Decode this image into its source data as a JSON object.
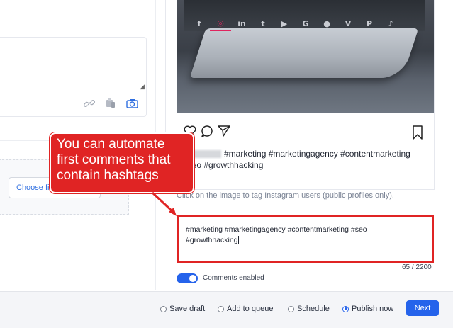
{
  "left_panel": {
    "upload_button_label": "Choose fi",
    "icons": [
      "link-icon",
      "media-library-icon",
      "camera-icon"
    ]
  },
  "network_tabs": [
    {
      "icon": "facebook-icon",
      "glyph": "f"
    },
    {
      "icon": "instagram-icon",
      "glyph": "◎",
      "active": true
    },
    {
      "icon": "linkedin-icon",
      "glyph": "in"
    },
    {
      "icon": "twitter-icon",
      "glyph": "t"
    },
    {
      "icon": "youtube-icon",
      "glyph": "▶"
    },
    {
      "icon": "google-icon",
      "glyph": "G"
    },
    {
      "icon": "reddit-icon",
      "glyph": "●"
    },
    {
      "icon": "vimeo-icon",
      "glyph": "V"
    },
    {
      "icon": "pinterest-icon",
      "glyph": "P"
    },
    {
      "icon": "tiktok-icon",
      "glyph": "♪"
    }
  ],
  "preview": {
    "caption_tags": "#marketing #marketingagency #contentmarketing",
    "caption_tags_line2": "#seo #growthhacking",
    "tag_hint": "Click on the image to tag Instagram users (public profiles only)."
  },
  "first_comment": {
    "line1": "#marketing #marketingagency #contentmarketing #seo",
    "line2": "#growthhacking",
    "char_count": "65 / 2200"
  },
  "comments_toggle": {
    "label": "Comments enabled",
    "enabled": true
  },
  "callout": {
    "text": "You can automate\nfirst comments that\ncontain hashtags"
  },
  "footer": {
    "options": [
      {
        "label": "Save draft",
        "selected": false
      },
      {
        "label": "Add to queue",
        "selected": false
      },
      {
        "label": "Schedule",
        "selected": false
      },
      {
        "label": "Publish now",
        "selected": true
      }
    ],
    "next_label": "Next"
  },
  "colors": {
    "accent": "#2563eb",
    "highlight": "#e02424",
    "instagram": "#e0245e"
  }
}
